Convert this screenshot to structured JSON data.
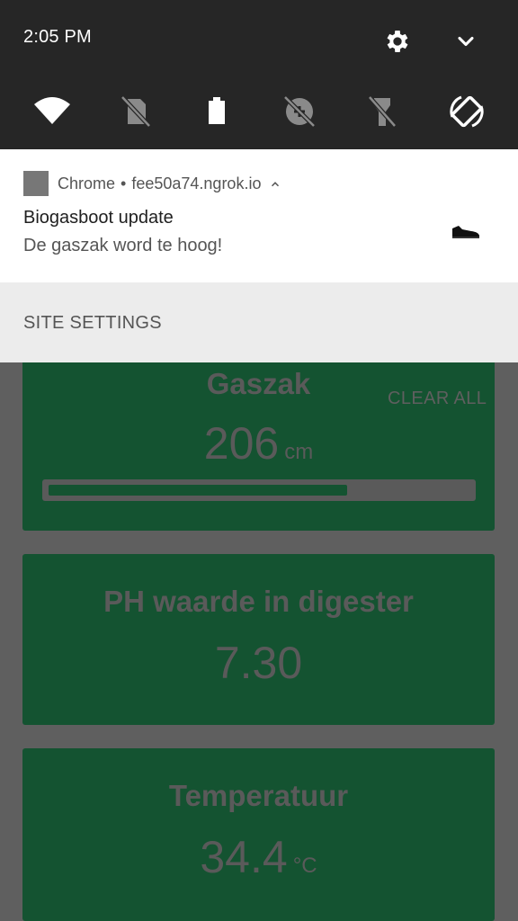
{
  "status_bar": {
    "time": "2:05 PM"
  },
  "quick_settings": {
    "tiles": [
      "wifi-icon",
      "no-sim-icon",
      "battery-icon",
      "data-saver-icon",
      "flashlight-icon",
      "auto-rotate-icon"
    ]
  },
  "notification": {
    "app_name": "Chrome",
    "separator": "•",
    "source": "fee50a74.ngrok.io",
    "title": "Biogasboot update",
    "text": "De gaszak word te hoog!",
    "action": "SITE SETTINGS"
  },
  "shade_actions": {
    "clear_all": "CLEAR ALL"
  },
  "page": {
    "cards": [
      {
        "title": "Gaszak",
        "value": "206",
        "unit": "cm",
        "progress_fraction": 0.71
      },
      {
        "title": "PH waarde in digester",
        "value": "7.30",
        "unit": ""
      },
      {
        "title": "Temperatuur",
        "value": "34.4",
        "unit": "°C"
      }
    ]
  },
  "colors": {
    "shade_bg": "#262626",
    "card_green_dimmed": "#145331",
    "scrim": "#5f5f5f"
  }
}
